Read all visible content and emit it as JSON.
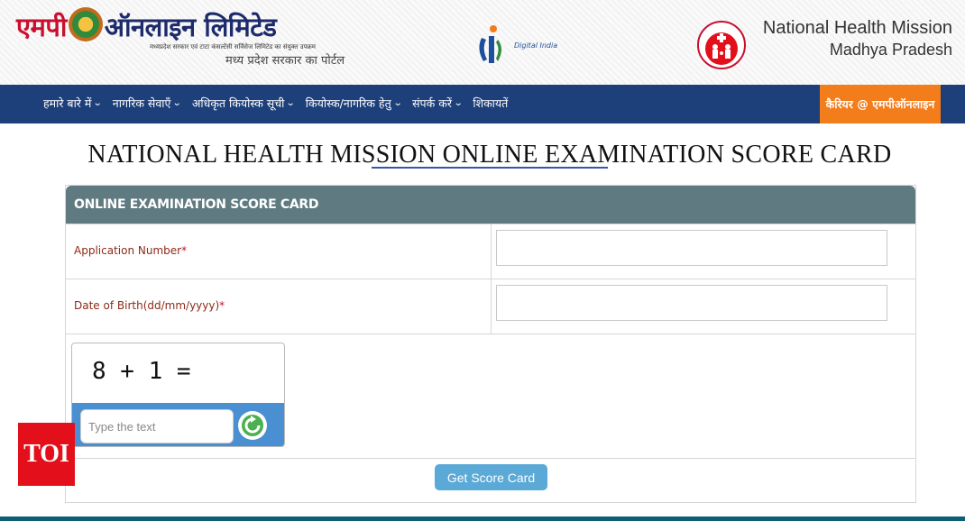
{
  "header": {
    "logo_brand": "एमपी",
    "logo_name": "ऑनलाइन  लिमिटेड",
    "logo_tagline": "मध्यप्रदेश सरकार एवं टाटा कंसल्टेंसी सर्विसेज लिमिटेड का संयुक्त उपक्रम",
    "logo_subtitle": "मध्य प्रदेश सरकार का पोर्टल",
    "digital_india_label": "Digital India",
    "nhm_line1": "National Health Mission",
    "nhm_line2": "Madhya Pradesh"
  },
  "nav": {
    "items": [
      {
        "label": "हमारे बारे में"
      },
      {
        "label": "नागरिक सेवाएँ"
      },
      {
        "label": "अधिकृत कियोस्क सूची"
      },
      {
        "label": "कियोस्क/नागरिक हेतु"
      },
      {
        "label": "संपर्क करें"
      },
      {
        "label": "शिकायतें"
      }
    ],
    "career_label": "कैरियर @ एमपीऑनलाइन"
  },
  "page_title": "NATIONAL HEALTH MISSION ONLINE EXAMINATION SCORE CARD",
  "form": {
    "header": "ONLINE EXAMINATION SCORE CARD",
    "application_label": "Application Number",
    "dob_label": "Date of Birth(dd/mm/yyyy)",
    "required_mark": "*",
    "application_value": "",
    "dob_value": "",
    "captcha_equation": "8 + 1 =",
    "captcha_placeholder": "Type the text",
    "submit_label": "Get Score Card"
  },
  "watermark": "TOI",
  "colors": {
    "nav_bg": "#1d3f7a",
    "career_bg": "#f37c1b",
    "panel_header": "#5f7a80",
    "label_color": "#8c2a16",
    "button": "#5aa9d6",
    "captcha_bar": "#4a8fd1"
  }
}
